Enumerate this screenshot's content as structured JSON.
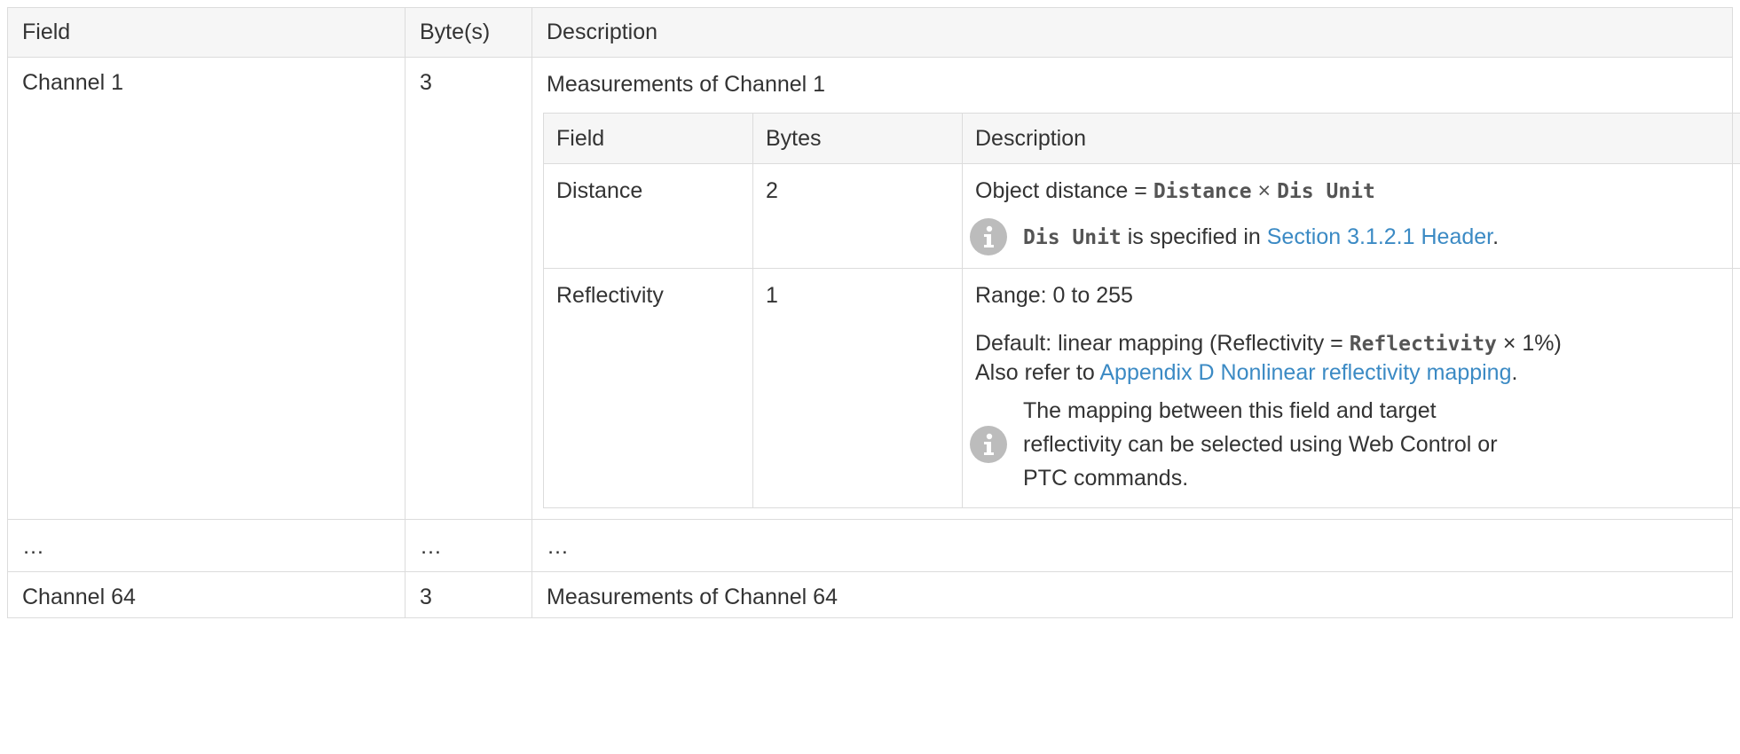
{
  "header": {
    "field": "Field",
    "bytes": "Byte(s)",
    "description": "Description"
  },
  "rows": [
    {
      "field": "Channel 1",
      "bytes": "3",
      "description": "Measurements of Channel 1"
    },
    {
      "field": "…",
      "bytes": "…",
      "description": "…"
    },
    {
      "field": "Channel 64",
      "bytes": "3",
      "description": "Measurements of Channel 64"
    }
  ],
  "inner": {
    "header": {
      "field": "Field",
      "bytes": "Bytes",
      "description": "Description"
    },
    "distance": {
      "field": "Distance",
      "bytes": "2",
      "desc_prefix": "Object distance = ",
      "code1": "Distance",
      "times": " × ",
      "code2": "Dis Unit",
      "note_code": "Dis Unit",
      "note_text": " is specified in ",
      "note_link": "Section 3.1.2.1 Header",
      "note_end": "."
    },
    "reflectivity": {
      "field": "Reflectivity",
      "bytes": "1",
      "range": "Range: 0 to 255",
      "default_prefix": "Default: linear mapping (Reflectivity = ",
      "default_code": "Reflectivity",
      "default_suffix": " × 1%)",
      "refer_prefix": "Also refer to ",
      "refer_link": "Appendix D Nonlinear reflectivity mapping",
      "refer_end": ".",
      "note": "The mapping between this field and target reflectivity can be selected using Web Control or PTC commands."
    }
  },
  "icons": {
    "note": "info-icon"
  },
  "colors": {
    "link": "#3b8ac4",
    "header_bg": "#f6f6f6",
    "border": "#dcdcdc",
    "icon_bg": "#bcbcbc"
  }
}
